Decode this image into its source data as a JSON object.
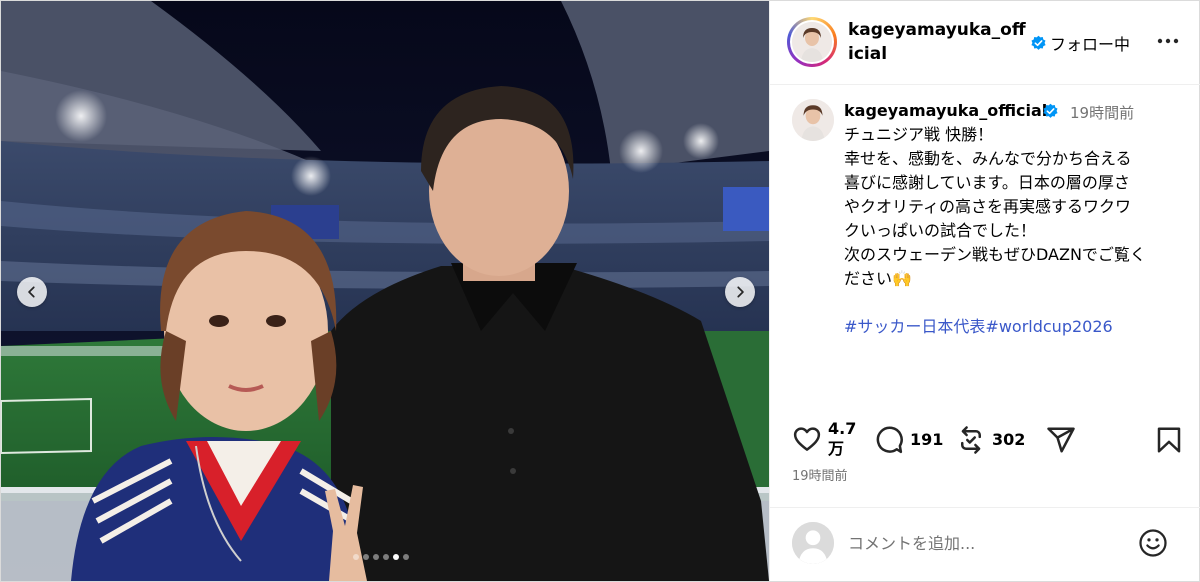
{
  "post": {
    "username": "kageyamayuka_official",
    "follow_label": "フォロー中",
    "caption": {
      "time": "19時間前",
      "lines": [
        "チュニジア戦 快勝！",
        "幸せを、感動を、みんなで分かち合える",
        "喜びに感謝しています。日本の層の厚さ",
        "やクオリティの高さを再実感するワクワ",
        "クいっぱいの試合でした！",
        "次のスウェーデン戦もぜひDAZNでご覧く",
        "ださい🙌"
      ],
      "hashtags": [
        "#サッカー日本代表",
        "#worldcup2026"
      ]
    },
    "stats": {
      "likes": "4.7万",
      "comments": "191",
      "reposts": "302"
    },
    "posted_time": "19時間前",
    "comment_placeholder": "コメントを追加...",
    "carousel": {
      "total": 6,
      "current_index": 4
    },
    "icons": {
      "verified": "verified-badge-icon",
      "more": "more-options-icon",
      "like": "heart-icon",
      "comment": "comment-bubble-icon",
      "repost": "repost-icon",
      "share": "send-paper-plane-icon",
      "save": "bookmark-icon",
      "emoji": "emoji-smiley-icon",
      "prev": "chevron-left-icon",
      "next": "chevron-right-icon"
    },
    "colors": {
      "verified": "#0095f6",
      "hashtag": "#3a58c9",
      "muted_text": "#737373"
    }
  }
}
